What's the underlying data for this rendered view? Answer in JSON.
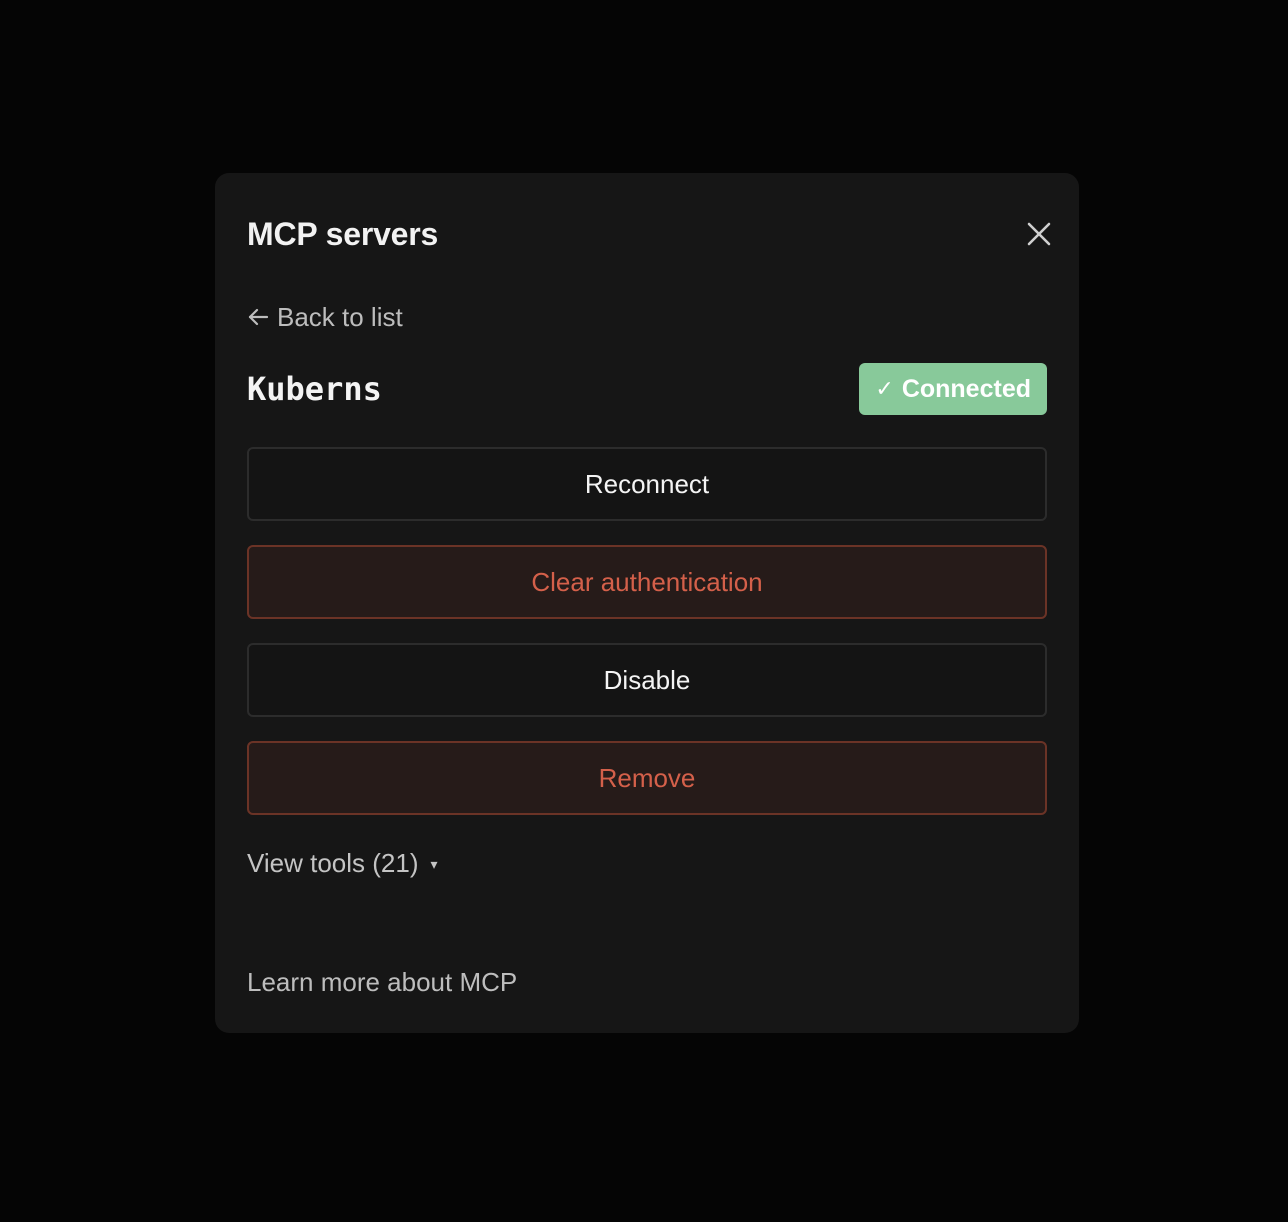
{
  "modal": {
    "title": "MCP servers",
    "close_icon": "close-icon"
  },
  "back": {
    "icon": "arrow-left-icon",
    "label": "Back to list"
  },
  "server": {
    "name": "Kuberns",
    "status": {
      "icon": "check-icon",
      "glyph": "✓",
      "label": "Connected",
      "color": "#88c99a"
    }
  },
  "actions": {
    "reconnect": "Reconnect",
    "clear_auth": "Clear authentication",
    "disable": "Disable",
    "remove": "Remove"
  },
  "tools": {
    "label": "View tools (21)",
    "caret_icon": "caret-down-icon",
    "caret": "▾"
  },
  "footer": {
    "learn_more": "Learn more about MCP"
  },
  "colors": {
    "backdrop": "#050505",
    "panel": "#161616",
    "danger_text": "#d4604a",
    "danger_border": "#6b3326",
    "success": "#88c99a"
  }
}
